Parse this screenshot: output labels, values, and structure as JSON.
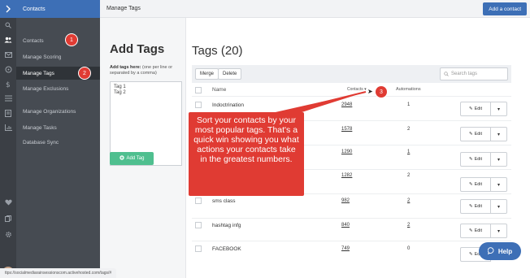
{
  "rail": {
    "top_icon": "chevron-right-icon",
    "icons": [
      "search-icon",
      "contacts-icon",
      "mail-icon",
      "automation-icon",
      "deals-icon",
      "lists-icon",
      "forms-icon",
      "reports-icon"
    ],
    "bottom_icons": [
      "heart-icon",
      "pages-icon",
      "gear-icon"
    ]
  },
  "submenu": {
    "header": "Contacts",
    "items": [
      {
        "label": "Contacts",
        "active": false
      },
      {
        "label": "Manage Scoring",
        "active": false
      },
      {
        "label": "Manage Tags",
        "active": true
      },
      {
        "label": "Manage Exclusions",
        "active": false
      },
      {
        "label": "Manage Organizations",
        "active": false
      },
      {
        "label": "Manage Tasks",
        "active": false
      },
      {
        "label": "Database Sync",
        "active": false
      }
    ]
  },
  "topbar": {
    "title": "Manage Tags",
    "add_contact_label": "Add a contact"
  },
  "add_tags": {
    "title": "Add Tags",
    "hint_bold": "Add tags here:",
    "hint_rest": " (one per line or separated by a comma)",
    "textarea_value": "Tag 1\nTag 2",
    "button_label": "Add Tag"
  },
  "tags": {
    "title": "Tags (20)",
    "merge_label": "Merge",
    "delete_label": "Delete",
    "search_placeholder": "Search tags",
    "col_name": "Name",
    "col_contacts": "Contacts",
    "col_automations": "Automations",
    "edit_label": "Edit",
    "rows": [
      {
        "name": "Indoctrination",
        "contacts": "2948",
        "automations": "1"
      },
      {
        "name": "",
        "contacts": "1578",
        "automations": "2"
      },
      {
        "name": "",
        "contacts": "1290",
        "automations": "1"
      },
      {
        "name": "",
        "contacts": "1282",
        "automations": "2"
      },
      {
        "name": "sms class",
        "contacts": "982",
        "automations": "2"
      },
      {
        "name": "hashtag infg",
        "contacts": "840",
        "automations": "2"
      },
      {
        "name": "FACEBOOK",
        "contacts": "749",
        "automations": "0"
      }
    ]
  },
  "annotations": {
    "badge1": "1",
    "badge2": "2",
    "badge3": "3",
    "callout": "Sort your contacts by your most popular tags. That's a quick win showing you what actions your contacts take in the greatest numbers.",
    "color": "#e03b33"
  },
  "statusbar": {
    "url": "ttps://socialmediarainsessionscom.activehosted.com/tags/#"
  },
  "help": {
    "label": "Help"
  }
}
